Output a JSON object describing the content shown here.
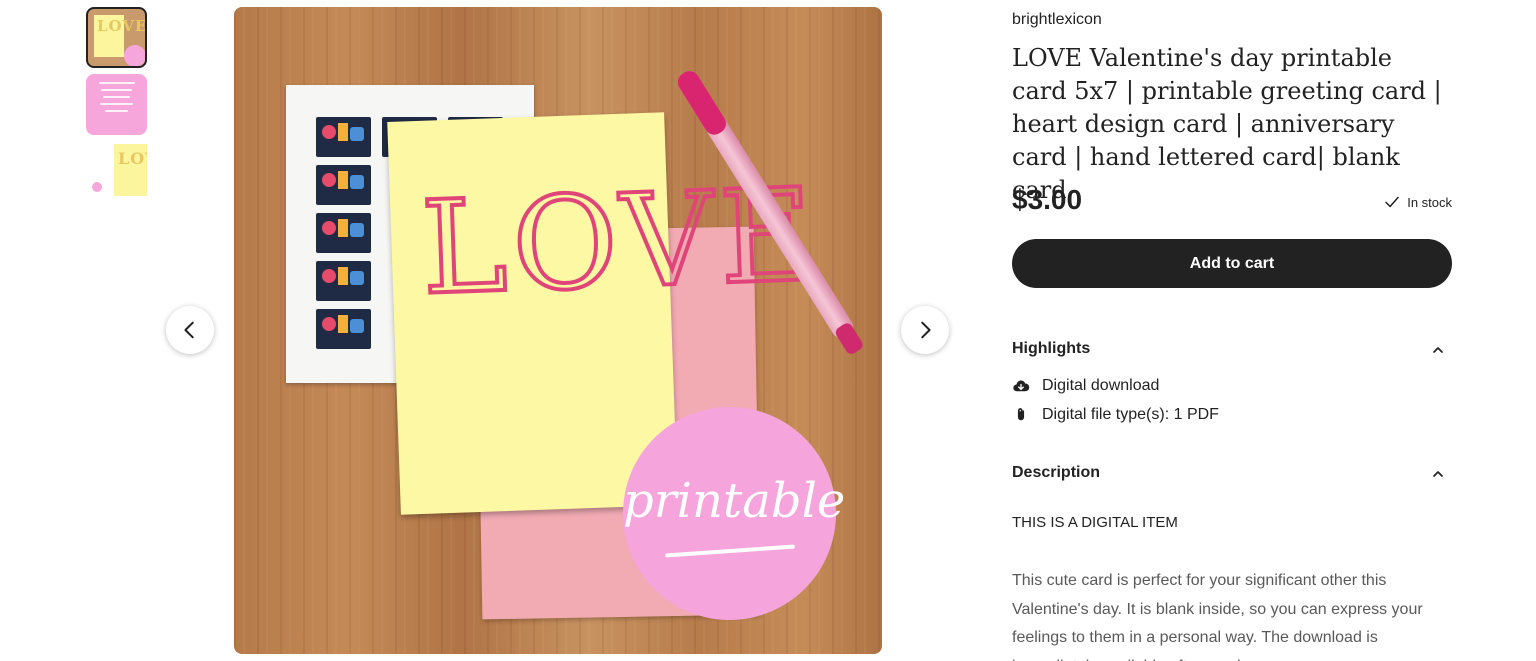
{
  "gallery": {
    "thumbnails": [
      {
        "label": "LOVE card photo thumbnail",
        "selected": true
      },
      {
        "label": "pink info thumbnail",
        "selected": false
      },
      {
        "label": "yellow card thumbnail",
        "selected": false
      }
    ],
    "main_image": {
      "card_text": "LOVE",
      "badge_text": "printable"
    },
    "prev_icon": "chevron-left-icon",
    "next_icon": "chevron-right-icon"
  },
  "listing": {
    "shop_name": "brightlexicon",
    "title": "LOVE Valentine's day printable card 5x7 | printable greeting card | heart design card | anniversary card | hand lettered card| blank card",
    "price": "$3.00",
    "stock_status": "In stock",
    "add_to_cart_label": "Add to cart"
  },
  "highlights": {
    "heading": "Highlights",
    "items": [
      {
        "icon": "cloud-download-icon",
        "text": "Digital download"
      },
      {
        "icon": "paperclip-icon",
        "text": "Digital file type(s): 1 PDF"
      }
    ]
  },
  "description": {
    "heading": "Description",
    "caption": "THIS IS A DIGITAL ITEM",
    "body": "This cute card is perfect for your significant other this Valentine's day. It is blank inside, so you can express your feelings to them in a personal way. The download is immediately available after purchase."
  },
  "colors": {
    "button_bg": "#222222",
    "badge_pink": "#f5a4dc",
    "card_yellow": "#fdf8a3"
  }
}
